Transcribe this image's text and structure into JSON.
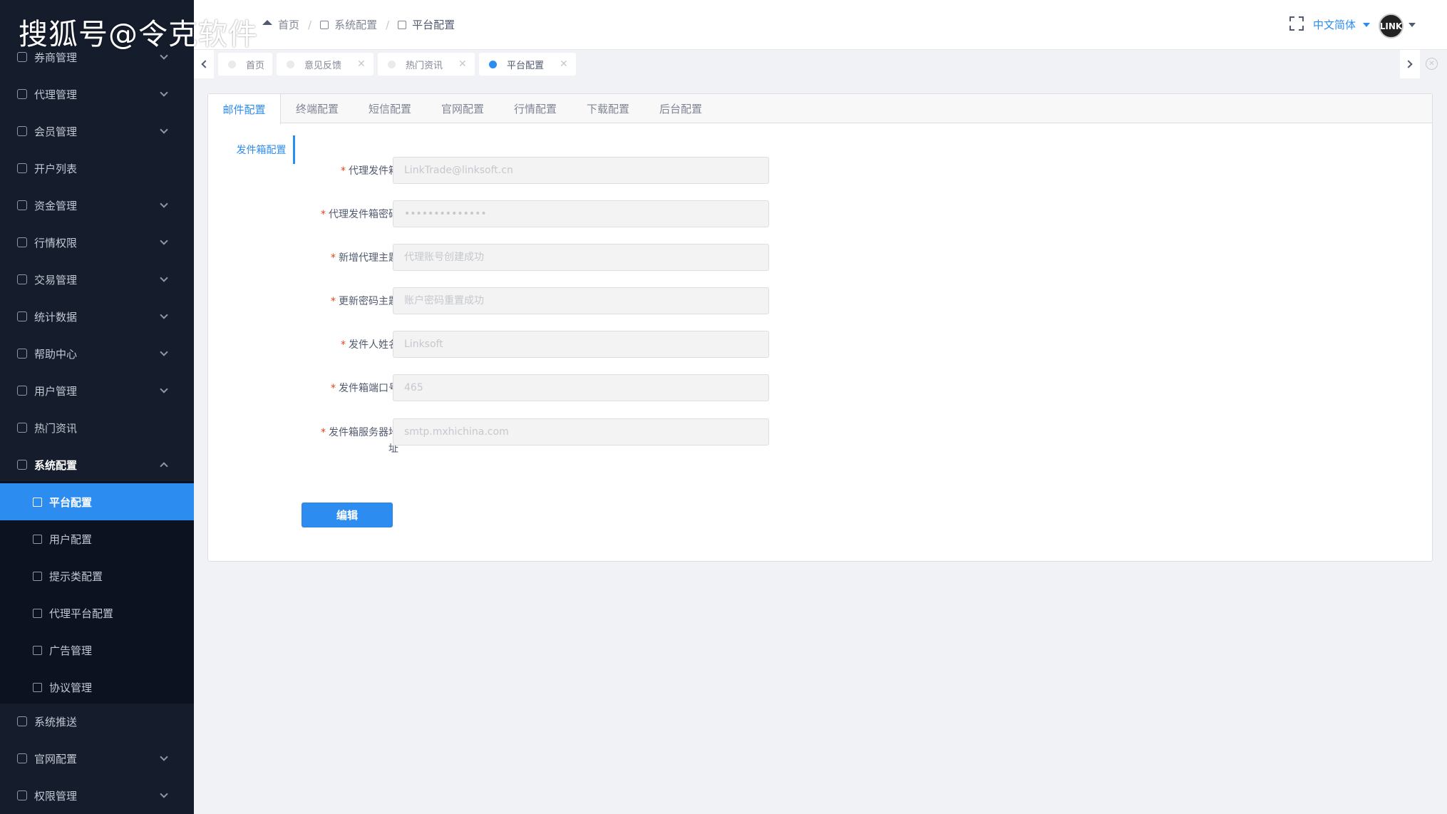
{
  "watermark": "搜狐号@令克软件",
  "sidebar": {
    "items": [
      {
        "label": "券商管理",
        "icon": "broker-icon",
        "chevron": "down"
      },
      {
        "label": "代理管理",
        "icon": "agent-icon",
        "chevron": "down"
      },
      {
        "label": "会员管理",
        "icon": "member-icon",
        "chevron": "down"
      },
      {
        "label": "开户列表",
        "icon": "list-icon",
        "chevron": ""
      },
      {
        "label": "资金管理",
        "icon": "wallet-icon",
        "chevron": "down"
      },
      {
        "label": "行情权限",
        "icon": "quote-icon",
        "chevron": "down"
      },
      {
        "label": "交易管理",
        "icon": "trade-icon",
        "chevron": "down"
      },
      {
        "label": "统计数据",
        "icon": "chart-icon",
        "chevron": "down"
      },
      {
        "label": "帮助中心",
        "icon": "help-icon",
        "chevron": "down"
      },
      {
        "label": "用户管理",
        "icon": "user-icon",
        "chevron": "down"
      },
      {
        "label": "热门资讯",
        "icon": "news-icon",
        "chevron": ""
      },
      {
        "label": "系统配置",
        "icon": "settings-icon",
        "chevron": "up"
      }
    ],
    "sub_items": [
      {
        "label": "平台配置",
        "icon": "monitor-icon",
        "active": true
      },
      {
        "label": "用户配置",
        "icon": "user-config-icon",
        "active": false
      },
      {
        "label": "提示类配置",
        "icon": "bulb-icon",
        "active": false
      },
      {
        "label": "代理平台配置",
        "icon": "agent-platform-icon",
        "active": false
      },
      {
        "label": "广告管理",
        "icon": "ad-icon",
        "active": false
      },
      {
        "label": "协议管理",
        "icon": "document-icon",
        "active": false
      }
    ],
    "bottom_items": [
      {
        "label": "系统推送",
        "icon": "send-icon",
        "chevron": ""
      },
      {
        "label": "官网配置",
        "icon": "website-icon",
        "chevron": "down"
      },
      {
        "label": "权限管理",
        "icon": "shield-icon",
        "chevron": "down"
      }
    ]
  },
  "header": {
    "breadcrumb": [
      "首页",
      "系统配置",
      "平台配置"
    ],
    "language": "中文简体",
    "avatar_text": "LINK"
  },
  "tabs": [
    {
      "label": "首页",
      "closable": false,
      "active": false
    },
    {
      "label": "意见反馈",
      "closable": true,
      "active": false
    },
    {
      "label": "热门资讯",
      "closable": true,
      "active": false
    },
    {
      "label": "平台配置",
      "closable": true,
      "active": true
    }
  ],
  "config_tabs": [
    "邮件配置",
    "终端配置",
    "短信配置",
    "官网配置",
    "行情配置",
    "下载配置",
    "后台配置"
  ],
  "sub_tab": "发件箱配置",
  "form": {
    "fields": [
      {
        "label": "代理发件箱",
        "value": "LinkTrade@linksoft.cn"
      },
      {
        "label": "代理发件箱密码",
        "value": "••••••••••••••"
      },
      {
        "label": "新增代理主题",
        "value": "代理账号创建成功"
      },
      {
        "label": "更新密码主题",
        "value": "账户密码重置成功"
      },
      {
        "label": "发件人姓名",
        "value": "Linksoft"
      },
      {
        "label": "发件箱端口号",
        "value": "465"
      },
      {
        "label": "发件箱服务器地",
        "label_line2": "址",
        "value": "smtp.mxhichina.com"
      }
    ],
    "submit_label": "编辑"
  },
  "colors": {
    "sidebar_bg": "#151c2c",
    "accent": "#2d8cf0",
    "required": "#ed4014"
  }
}
